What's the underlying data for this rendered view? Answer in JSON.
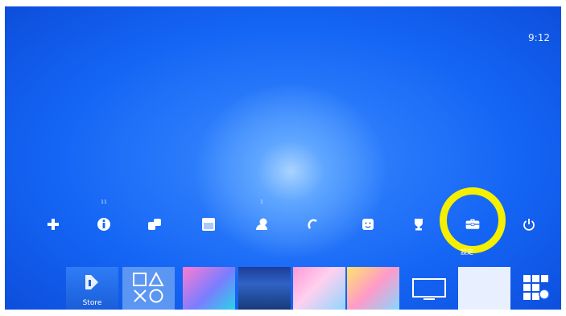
{
  "status_bar": {
    "time": "9:12"
  },
  "function_area": {
    "items": [
      {
        "name": "whats-new",
        "icon": "plus-icon"
      },
      {
        "name": "notifications",
        "icon": "info-icon",
        "badge": "11"
      },
      {
        "name": "friends",
        "icon": "friends-icon"
      },
      {
        "name": "events",
        "icon": "calendar-icon"
      },
      {
        "name": "party",
        "icon": "party-icon",
        "badge": "1"
      },
      {
        "name": "playstation-plus",
        "icon": "plus-membership-icon"
      },
      {
        "name": "profile",
        "icon": "profile-icon"
      },
      {
        "name": "trophies",
        "icon": "trophy-icon"
      },
      {
        "name": "settings",
        "icon": "toolbox-icon",
        "label": "設定",
        "selected": true
      },
      {
        "name": "power",
        "icon": "power-icon"
      }
    ]
  },
  "highlight": {
    "color": "#f5ef00",
    "target": "settings"
  },
  "content_area": {
    "tiles": [
      {
        "name": "playstation-store",
        "label": "Store",
        "icon": "playstation-logo-icon"
      },
      {
        "name": "library",
        "icon": "ps-shapes-icon"
      },
      {
        "name": "game-1"
      },
      {
        "name": "game-2"
      },
      {
        "name": "game-3"
      },
      {
        "name": "game-4"
      },
      {
        "name": "tv-video",
        "icon": "tv-icon"
      },
      {
        "name": "app-tile"
      },
      {
        "name": "library-grid",
        "icon": "grid-icon"
      }
    ]
  },
  "colors": {
    "background": "#1565f5",
    "glow": "#a9d3ff",
    "icon": "#ffffff"
  }
}
